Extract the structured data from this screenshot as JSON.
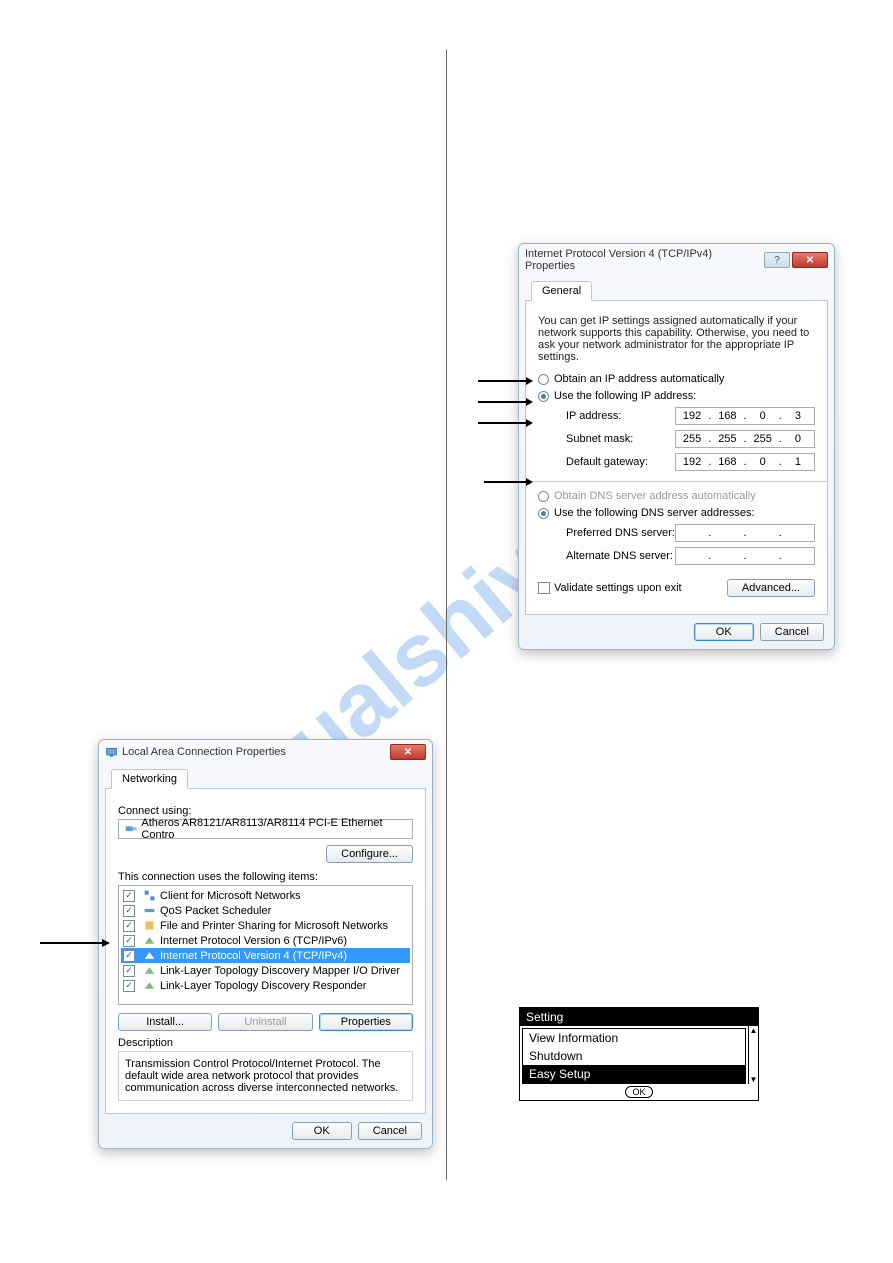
{
  "watermark": "manualshive.com",
  "ipv4_dialog": {
    "title": "Internet Protocol Version 4 (TCP/IPv4) Properties",
    "tab": "General",
    "intro": "You can get IP settings assigned automatically if your network supports this capability. Otherwise, you need to ask your network administrator for the appropriate IP settings.",
    "opt_auto": "Obtain an IP address automatically",
    "opt_manual": "Use the following IP address:",
    "fields": {
      "ip_label": "IP address:",
      "ip": [
        "192",
        "168",
        "0",
        "3"
      ],
      "subnet_label": "Subnet mask:",
      "subnet": [
        "255",
        "255",
        "255",
        "0"
      ],
      "gateway_label": "Default gateway:",
      "gateway": [
        "192",
        "168",
        "0",
        "1"
      ]
    },
    "dns_auto": "Obtain DNS server address automatically",
    "dns_manual": "Use the following DNS server addresses:",
    "pref_dns_label": "Preferred DNS server:",
    "pref_dns": [
      "",
      "",
      "",
      ""
    ],
    "alt_dns_label": "Alternate DNS server:",
    "alt_dns": [
      "",
      "",
      "",
      ""
    ],
    "validate": "Validate settings upon exit",
    "advanced": "Advanced...",
    "ok": "OK",
    "cancel": "Cancel"
  },
  "lan_dialog": {
    "title": "Local Area Connection Properties",
    "tab": "Networking",
    "connect_using_label": "Connect using:",
    "adapter": "Atheros AR8121/AR8113/AR8114 PCI-E Ethernet Contro",
    "configure": "Configure...",
    "items_label": "This connection uses the following items:",
    "items": [
      "Client for Microsoft Networks",
      "QoS Packet Scheduler",
      "File and Printer Sharing for Microsoft Networks",
      "Internet Protocol Version 6 (TCP/IPv6)",
      "Internet Protocol Version 4 (TCP/IPv4)",
      "Link-Layer Topology Discovery Mapper I/O Driver",
      "Link-Layer Topology Discovery Responder"
    ],
    "install": "Install...",
    "uninstall": "Uninstall",
    "properties": "Properties",
    "desc_title": "Description",
    "desc_text": "Transmission Control Protocol/Internet Protocol. The default wide area network protocol that provides communication across diverse interconnected networks.",
    "ok": "OK",
    "cancel": "Cancel"
  },
  "device": {
    "title": "Setting",
    "rows": [
      "View Information",
      "Shutdown",
      "Easy Setup"
    ],
    "footer": "OK"
  }
}
